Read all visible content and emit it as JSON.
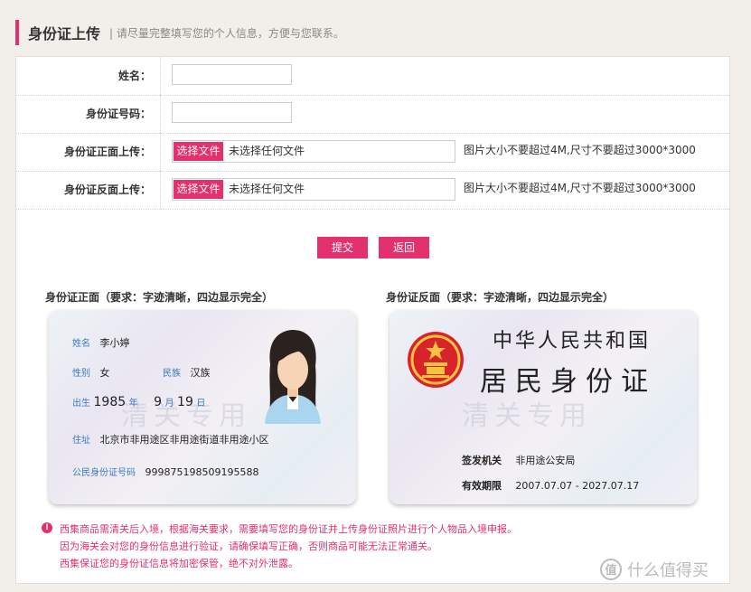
{
  "header": {
    "title": "身份证上传",
    "subtitle": "| 请尽量完整填写您的个人信息，方便与您联系。"
  },
  "form": {
    "name_label": "姓名：",
    "id_number_label": "身份证号码：",
    "front_label": "身份证正面上传：",
    "back_label": "身份证反面上传：",
    "choose_file": "选择文件",
    "no_file": "未选择任何文件",
    "hint": "图片大小不要超过4M,尺寸不要超过3000*3000"
  },
  "buttons": {
    "submit": "提交",
    "back": "返回"
  },
  "sample": {
    "front_title": "身份证正面（要求：字迹清晰，四边显示完全）",
    "back_title": "身份证反面（要求：字迹清晰，四边显示完全）",
    "front": {
      "name_key": "姓名",
      "name_val": "李小婷",
      "gender_key": "性别",
      "gender_val": "女",
      "ethnic_key": "民族",
      "ethnic_val": "汉族",
      "birth_key": "出生",
      "birth_year": "1985",
      "year_unit": "年",
      "birth_month": "9",
      "month_unit": "月",
      "birth_day": "19",
      "day_unit": "日",
      "addr_key": "住址",
      "addr_val": "北京市非用途区非用途街道非用途小区",
      "idno_key": "公民身份证号码",
      "idno_val": "999875198509195588",
      "watermark": "清关专用"
    },
    "back": {
      "country": "中华人民共和国",
      "card_name": "居民身份证",
      "authority_key": "签发机关",
      "authority_val": "非用途公安局",
      "validity_key": "有效期限",
      "validity_val": "2007.07.07 - 2027.07.17",
      "watermark": "清关专用"
    }
  },
  "notice": {
    "icon": "!",
    "line1": "西集商品需清关后入境，根据海关要求，需要填写您的身份证并上传身份证照片进行个人物品入境申报。",
    "line2": "因为海关会对您的身份信息进行验证，请确保填写正确，否则商品可能无法正常通关。",
    "line3": "西集保证您的身份证信息将加密保管，绝不对外泄露。"
  },
  "brand": {
    "logo": "值",
    "text": "什么值得买"
  },
  "colors": {
    "accent": "#e3306e",
    "background": "#f2efea"
  }
}
